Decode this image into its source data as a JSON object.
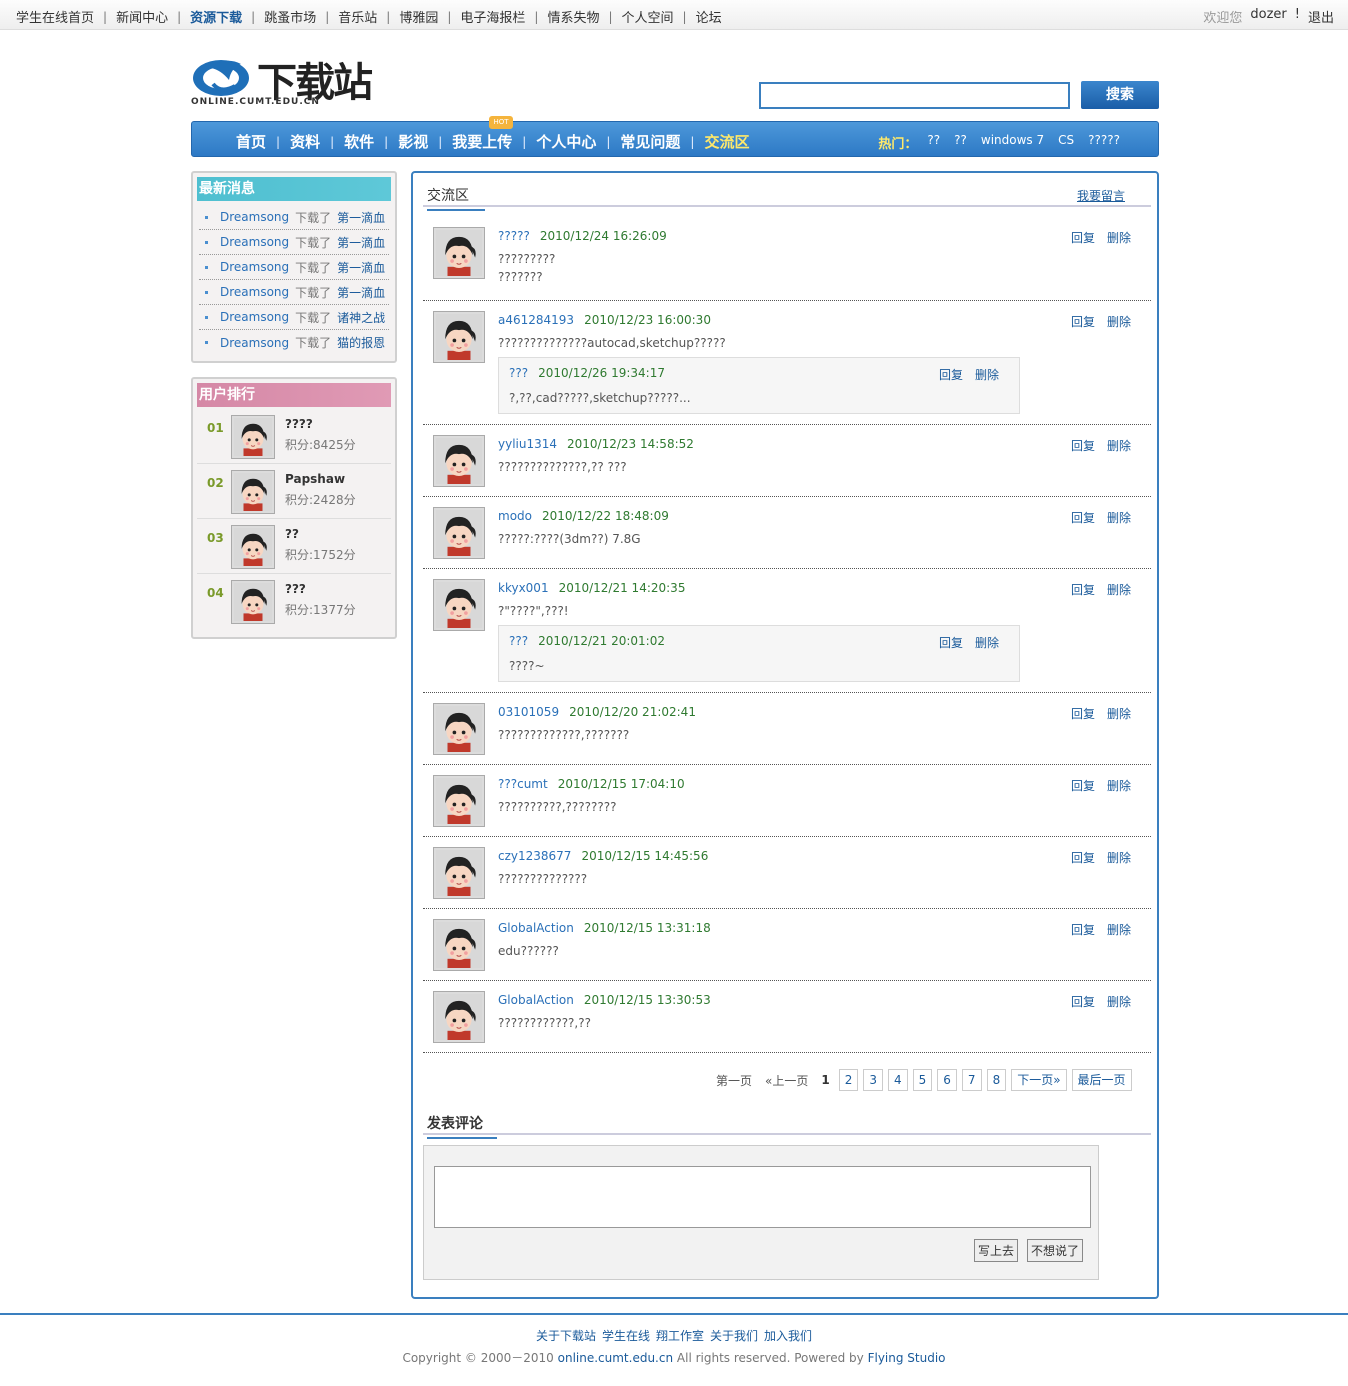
{
  "topbar": {
    "links": [
      "学生在线首页",
      "新闻中心",
      "资源下载",
      "跳蚤市场",
      "音乐站",
      "博雅园",
      "电子海报栏",
      "情系失物",
      "个人空间",
      "论坛"
    ],
    "current_index": 2,
    "welcome": "欢迎您",
    "username": "dozer",
    "excl": "!",
    "logout": "退出"
  },
  "header": {
    "logo_text": "下载站",
    "logo_sub": "ONLINE.CUMT.EDU.CN",
    "search_placeholder": "",
    "search_button": "搜索"
  },
  "mainnav": {
    "items": [
      "首页",
      "资料",
      "软件",
      "影视",
      "我要上传",
      "个人中心",
      "常见问题",
      "交流区"
    ],
    "current_index": 7,
    "hot_badge": "HOT",
    "hot_label": "热门：",
    "hot_words": [
      "??",
      "??",
      "windows 7",
      "CS",
      "?????"
    ]
  },
  "news": {
    "title": "最新消息",
    "items": [
      {
        "user": "Dreamsong",
        "verb": "下载了",
        "target": "第一滴血"
      },
      {
        "user": "Dreamsong",
        "verb": "下载了",
        "target": "第一滴血"
      },
      {
        "user": "Dreamsong",
        "verb": "下载了",
        "target": "第一滴血"
      },
      {
        "user": "Dreamsong",
        "verb": "下载了",
        "target": "第一滴血"
      },
      {
        "user": "Dreamsong",
        "verb": "下载了",
        "target": "诸神之战"
      },
      {
        "user": "Dreamsong",
        "verb": "下载了",
        "target": "猫的报恩"
      }
    ]
  },
  "ranking": {
    "title": "用户排行",
    "items": [
      {
        "no": "01",
        "name": "????",
        "score": "积分:8425分"
      },
      {
        "no": "02",
        "name": "Papshaw",
        "score": "积分:2428分"
      },
      {
        "no": "03",
        "name": "??",
        "score": "积分:1752分"
      },
      {
        "no": "04",
        "name": "???",
        "score": "积分:1377分"
      }
    ]
  },
  "board": {
    "title": "交流区",
    "post_link": "我要留言",
    "reply_label": "回复",
    "delete_label": "删除",
    "comments": [
      {
        "name": "?????",
        "time": "2010/12/24 16:26:09",
        "body": [
          "?????????",
          "???????"
        ]
      },
      {
        "name": "a461284193",
        "time": "2010/12/23 16:00:30",
        "body": [
          "??????????????autocad,sketchup?????"
        ],
        "reply": {
          "name": "???",
          "time": "2010/12/26 19:34:17",
          "body": "?,??,cad?????,sketchup?????..."
        }
      },
      {
        "name": "yyliu1314",
        "time": "2010/12/23 14:58:52",
        "body": [
          "??????????????,??  ???"
        ]
      },
      {
        "name": "modo",
        "time": "2010/12/22 18:48:09",
        "body": [
          "?????:????(3dm??) 7.8G"
        ]
      },
      {
        "name": "kkyx001",
        "time": "2010/12/21 14:20:35",
        "body": [
          "?\"????\",???!"
        ],
        "reply": {
          "name": "???",
          "time": "2010/12/21 20:01:02",
          "body": "????~"
        }
      },
      {
        "name": "03101059",
        "time": "2010/12/20 21:02:41",
        "body": [
          "?????????????,???????"
        ]
      },
      {
        "name": "???cumt",
        "time": "2010/12/15 17:04:10",
        "body": [
          "??????????,????????"
        ]
      },
      {
        "name": "czy1238677",
        "time": "2010/12/15 14:45:56",
        "body": [
          "??????????????"
        ]
      },
      {
        "name": "GlobalAction",
        "time": "2010/12/15 13:31:18",
        "body": [
          "edu??????"
        ]
      },
      {
        "name": "GlobalAction",
        "time": "2010/12/15 13:30:53",
        "body": [
          "????????????,??"
        ]
      }
    ]
  },
  "pager": {
    "first": "第一页",
    "prev": "«上一页",
    "current": "1",
    "pages": [
      "2",
      "3",
      "4",
      "5",
      "6",
      "7",
      "8"
    ],
    "next": "下一页»",
    "last": "最后一页"
  },
  "post": {
    "title": "发表评论",
    "submit": "写上去",
    "cancel": "不想说了"
  },
  "footer": {
    "links": [
      "关于下载站",
      "学生在线",
      "翔工作室",
      "关于我们",
      "加入我们"
    ],
    "copyright_pre": "Copyright © 2000－2010",
    "domain": "online.cumt.edu.cn",
    "copyright_mid": "All rights reserved. Powered by",
    "studio": "Flying Studio"
  }
}
